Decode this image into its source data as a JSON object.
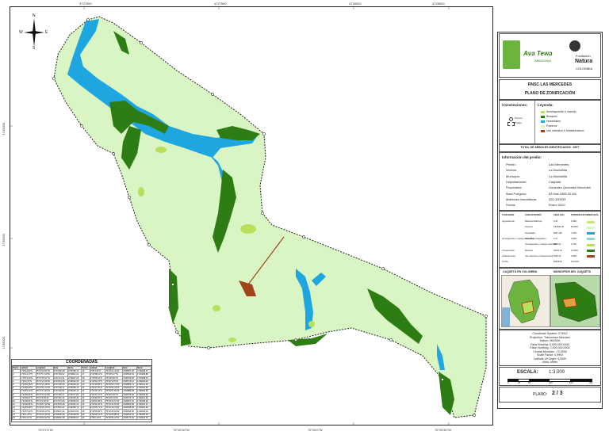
{
  "map": {
    "top_coords": [
      "4727000",
      "4727500",
      "4728000",
      "4728500"
    ],
    "bottom_coords": [
      "75°27'0\"W",
      "75°26'30\"W",
      "75°26'0\"W",
      "75°25'30\"W"
    ],
    "left_coords": [
      "1740000",
      "1739500",
      "1739000"
    ],
    "north_labels": {
      "n": "N",
      "s": "S",
      "e": "E",
      "w": "W"
    }
  },
  "legend_panel": {
    "logo_text_1": "Ava Tewa",
    "logo_text_2": "AMAZONIA",
    "logo_text_3": "Fundación",
    "logo_text_4": "Natura",
    "logo_text_5": "COLOMBIA",
    "title": "RNSC LAS MERCEDES",
    "subtitle": "PLANO DE ZONIFICACIÓN",
    "conventions_label": "Convenciones:",
    "conventions_items": [
      "Puntos",
      "Predio"
    ],
    "legend_label": "Leyenda:",
    "legend_items": [
      {
        "label": "Amortiguación y manejo",
        "color": "#b8e05a"
      },
      {
        "label": "Bosques",
        "color": "#2e7d14"
      },
      {
        "label": "Humedales",
        "color": "#1ea6e0"
      },
      {
        "label": "Potreros",
        "color": "#d9f5c4"
      },
      {
        "label": "Uso intensivo e Infraestructura",
        "color": "#a0421a"
      }
    ],
    "total_trees": "TOTAL DE ARBOLES IDENTIFICADOS : 6977",
    "info_title": "Información del predio:",
    "info_rows": [
      {
        "k": "Predio:",
        "v": "Las Mercedes"
      },
      {
        "k": "Vereda:",
        "v": "La Montañita"
      },
      {
        "k": "Municipio:",
        "v": "La Montañita"
      },
      {
        "k": "Departamento:",
        "v": "Caquetá"
      },
      {
        "k": "Propietario:",
        "v": "Gonzalez Quesada Mercedes"
      },
      {
        "k": "Área Polígono:",
        "v": "83 Has 4389,32 M2"
      },
      {
        "k": "Matrícula Inmobiliaria:",
        "v": "420-100333"
      },
      {
        "k": "Fecha:",
        "v": "Enero 2022"
      }
    ],
    "area_table_header": [
      "CATEGORÍA",
      "SUBCATEGORÍA",
      "ÁREA (HA)",
      "PORCENTAJE",
      "SIMBOLOGÍA"
    ],
    "area_rows": [
      {
        "cat": "Agrosistemas",
        "sub": "Barbecho/Rastrojo",
        "area": "0,40",
        "pct": "0,48%",
        "color": "#c8e86a"
      },
      {
        "cat": "",
        "sub": "Potreros",
        "area": "54,8944,00",
        "pct": "65,68%",
        "color": "#d9f5c4"
      },
      {
        "cat": "",
        "sub": "Humedales",
        "area": "6067,118",
        "pct": "7,26%",
        "color": "#1ea6e0"
      },
      {
        "cat": "Amortiguación y manejo sostenible",
        "sub": "Zona de amortiguación",
        "area": "0,47",
        "pct": "0,56%",
        "color": "#8fd4d4"
      },
      {
        "cat": "",
        "sub": "Amortiguación y manejo sostenible",
        "area": "3135,21",
        "pct": "3,76%",
        "color": "#b8e05a"
      },
      {
        "cat": "Conservación",
        "sub": "Bosques",
        "area": "18031,33",
        "pct": "21,58%",
        "color": "#2e7d14"
      },
      {
        "cat": "Infraestructura",
        "sub": "Uso intensivo e Infraestructura",
        "area": "5693,36",
        "pct": "0,68%",
        "color": "#a0421a"
      },
      {
        "cat": "TOTAL",
        "sub": "",
        "area": "83438,32",
        "pct": "100,00%",
        "color": "#ffffff"
      }
    ],
    "minimap_label_1": "CAQUETÁ EN COLOMBIA",
    "minimap_label_2": "MUNICIPIOS DEL CAQUETÁ",
    "crs_lines": [
      "Coordinate System: CTM12",
      "Projection: Transverse Mercator",
      "Datum: MAGNA",
      "False Easting: 5.000.000,0000",
      "False Northing: 2.000.000,0000",
      "Central Meridian: -73,0000",
      "Scale Factor: 0,9992",
      "Latitude Of Origin: 4,0000",
      "Units: Meter"
    ],
    "scale_label": "ESCALA:",
    "scale_value": "1:3.000",
    "scale_ticks": [
      "0",
      "25",
      "50",
      "100",
      "150",
      "200"
    ],
    "plan_label": "PLANO:",
    "plan_value": "2 / 3"
  },
  "coords_table": {
    "title": "COORDENADAS",
    "header": [
      "Punto",
      "Latitud",
      "Longitud",
      "Este",
      "Norte",
      "Punto",
      "Latitud",
      "Longitud",
      "Este",
      "Norte"
    ],
    "rows": [
      [
        "1",
        "1°35'10,82\"N",
        "75°27'22,51\"W",
        "4727063,98",
        "1739798,14",
        "16",
        "1°35'1,82\"N",
        "75°26'12,44\"W",
        "4728567,28",
        "1739488,67"
      ],
      [
        "2",
        "1°35'12,47\"N",
        "75°27'17,23\"W",
        "4727163,02",
        "1739842,41",
        "17",
        "1°34'58,61\"N",
        "75°26'9,27\"W",
        "4728632,54",
        "1739389,88"
      ],
      [
        "3",
        "1°35'15,23\"N",
        "75°27'18,61\"W",
        "4727141,41",
        "1739927,06",
        "18",
        "1°34'55,62\"N",
        "75°26'6,81\"W",
        "4728708,08",
        "1739298,49"
      ],
      [
        "4",
        "1°35'2,04\"N",
        "75°27'24,06\"W",
        "4727051,68",
        "1739522,08",
        "19",
        "1°34'52,75\"N",
        "75°26'3,26\"W",
        "4728779,12",
        "1739209,46"
      ],
      [
        "5",
        "1°34'59,35\"N",
        "75°27'21,48\"W",
        "4727105,25",
        "1739439,46",
        "20",
        "1°34'49,86\"N",
        "75°25'59,71\"W",
        "4728850,74",
        "1739121,02"
      ],
      [
        "6",
        "1°34'56,06\"N",
        "75°27'19,73\"W",
        "4727139,71",
        "1739338,79",
        "21",
        "1°34'47,05\"N",
        "75°25'56,44\"W",
        "4728916,54",
        "1739034,60"
      ],
      [
        "7",
        "1°34'53,14\"N",
        "75°27'17,04\"W",
        "4727192,82",
        "1739249,13",
        "22",
        "1°34'45,72\"N",
        "75°25'57,84\"W",
        "4728888,08",
        "1738993,86"
      ],
      [
        "8",
        "1°34'50,82\"N",
        "75°27'13,24\"W",
        "4727266,47",
        "1739177,83",
        "23",
        "1°34'47,21\"N",
        "75°26'2,51\"W",
        "4728795,92",
        "1739039,66"
      ],
      [
        "9",
        "1°34'49,47\"N",
        "75°27'8,05\"W",
        "4727367,63",
        "1739136,33",
        "24",
        "1°34'49,59\"N",
        "75°26'6,12\"W",
        "4728724,73",
        "1739112,68"
      ],
      [
        "10",
        "1°34'48,04\"N",
        "75°27'2,62\"W",
        "4727473,05",
        "1739092,50",
        "25",
        "1°34'52,06\"N",
        "75°26'10,07\"W",
        "4728647,62",
        "1739188,48"
      ],
      [
        "11",
        "1°34'49,95\"N",
        "75°26'57,33\"W",
        "4727576,48",
        "1739151,12",
        "26",
        "1°34'54,18\"N",
        "75°26'14,52\"W",
        "4728560,55",
        "1739253,67"
      ],
      [
        "12",
        "1°34'53,68\"N",
        "75°26'45,79\"W",
        "4727801,41",
        "1739265,71",
        "27",
        "1°34'55,71\"N",
        "75°26'19,73\"W",
        "4728458,38",
        "1739300,82"
      ],
      [
        "13",
        "1°34'57,22\"N",
        "75°26'33,14\"W",
        "4728047,94",
        "1739374,66",
        "28",
        "1°34'56,86\"N",
        "75°26'25,04\"W",
        "4728354,86",
        "1739336,03"
      ],
      [
        "14",
        "1°35'1,25\"N",
        "75°26'23,49\"W",
        "4728235,89",
        "1739498,58",
        "29",
        "1°34'58,41\"N",
        "75°26'29,88\"W",
        "4728260,42",
        "1739383,69"
      ],
      [
        "15",
        "1°35'3,12\"N",
        "75°26'16,02\"W",
        "4728381,38",
        "1739556,07",
        "30",
        "1°35'0,13\"N",
        "75°26'34,24\"W",
        "4728175,46",
        "1739436,54"
      ]
    ]
  }
}
